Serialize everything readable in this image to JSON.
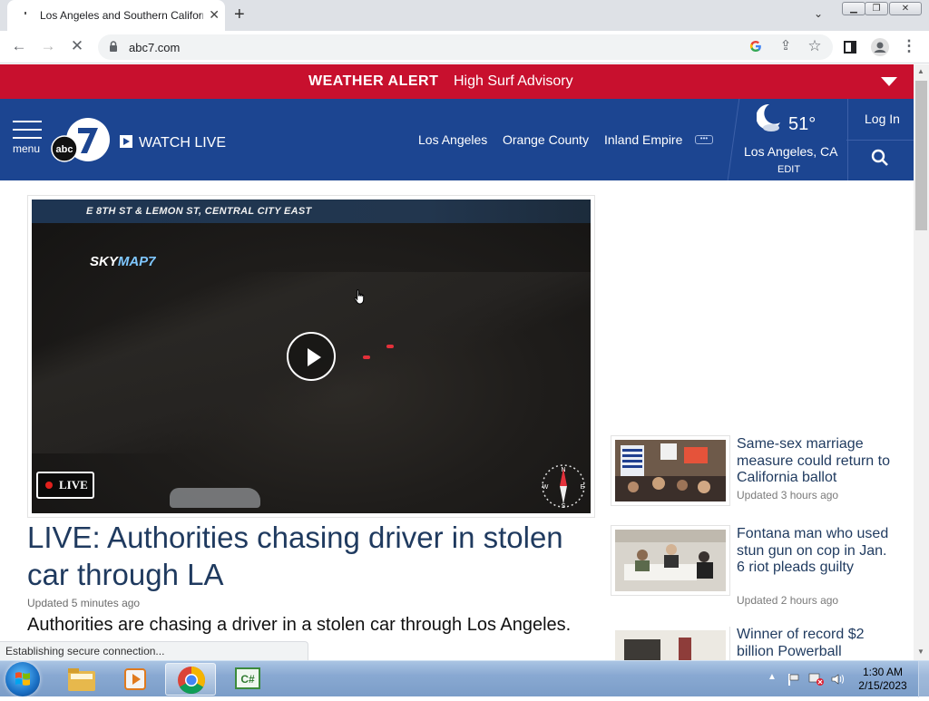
{
  "browser": {
    "tab_title": "Los Angeles and Southern California",
    "url": "abc7.com",
    "status_text": "Establishing secure connection..."
  },
  "alert": {
    "label": "WEATHER ALERT",
    "message": "High Surf Advisory",
    "color": "#c8102e"
  },
  "header": {
    "menu_label": "menu",
    "watch_live": "WATCH LIVE",
    "nav": [
      "Los Angeles",
      "Orange County",
      "Inland Empire"
    ],
    "more_icon": "ellipsis-icon",
    "temperature": "51°",
    "location": "Los Angeles, CA",
    "edit": "EDIT",
    "login": "Log In",
    "brand_color": "#1c4591"
  },
  "video": {
    "street_caption": "E 8TH ST & LEMON ST, CENTRAL CITY EAST",
    "skymap_a": "SKY",
    "skymap_b": "MAP7",
    "live_badge": "LIVE"
  },
  "main": {
    "headline": "LIVE: Authorities chasing driver in stolen car through LA",
    "updated": "Updated 5 minutes ago",
    "summary": "Authorities are chasing a driver in a stolen car through Los Angeles."
  },
  "stories": [
    {
      "title": "Same-sex marriage measure could return to California ballot",
      "updated": "Updated 3 hours ago"
    },
    {
      "title": "Fontana man who used stun gun on cop in Jan. 6 riot pleads guilty",
      "updated": "Updated 2 hours ago"
    },
    {
      "title": "Winner of record $2 billion Powerball",
      "updated": ""
    }
  ],
  "taskbar": {
    "time": "1:30 AM",
    "date": "2/15/2023"
  }
}
